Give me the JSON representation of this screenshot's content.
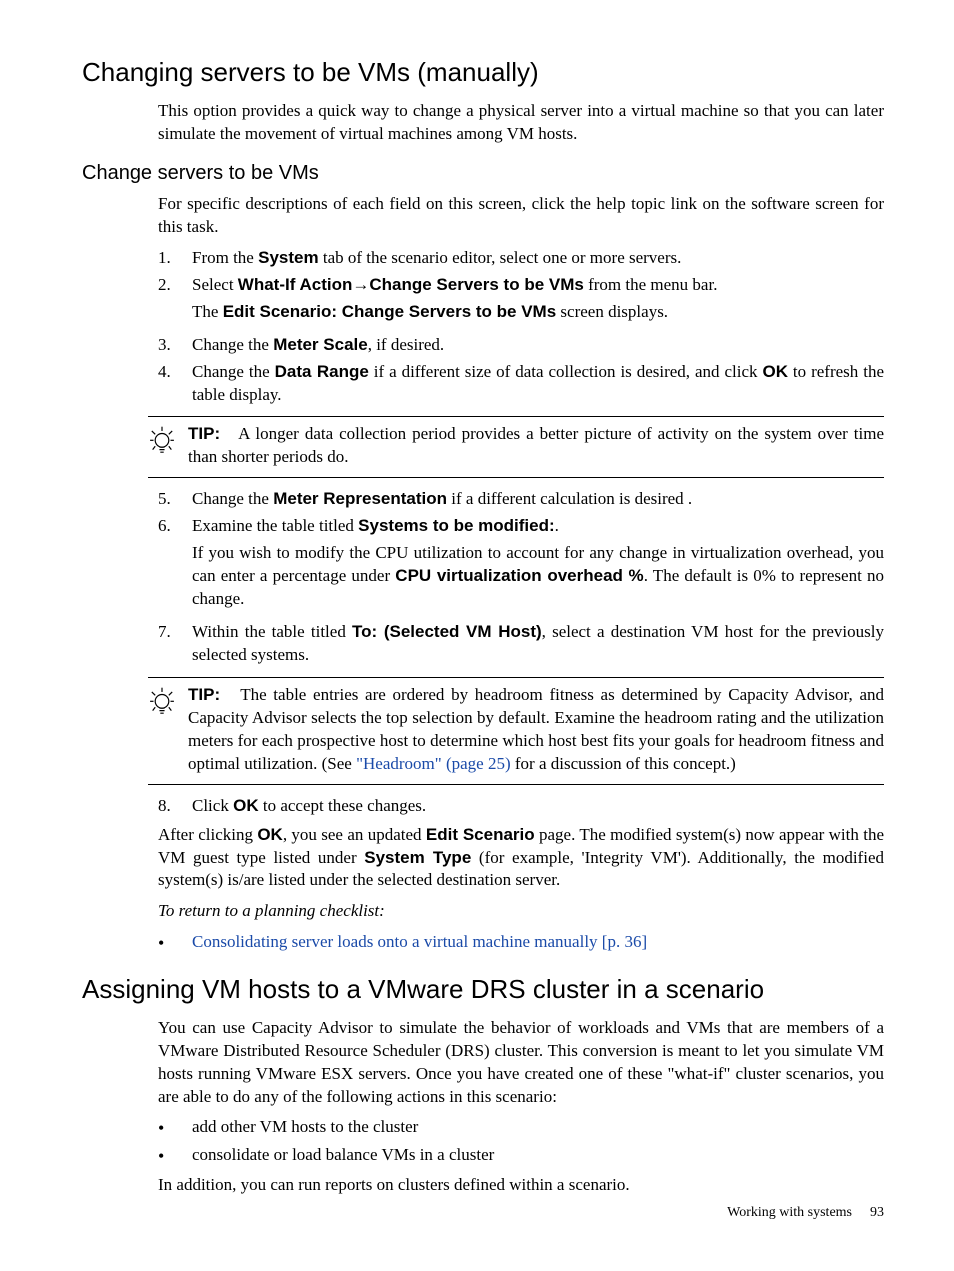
{
  "section1": {
    "title": "Changing servers to be VMs (manually)",
    "intro": "This option provides a quick way to change a physical server into a virtual machine so that you can later simulate the movement of virtual machines among VM hosts.",
    "subheading": "Change servers to be VMs",
    "sub_intro": "For specific descriptions of each field on this screen, click the help topic link on the software screen for this task.",
    "steps_a": {
      "s1_pre": "From the ",
      "s1_system": "System",
      "s1_post": " tab of the scenario editor, select one or more servers.",
      "s2_pre": "Select ",
      "s2_whatif": "What-If Action",
      "s2_arrow": "→",
      "s2_change": "Change Servers to be VMs",
      "s2_post": " from the menu bar.",
      "s2_line2_pre": "The ",
      "s2_line2_bold": "Edit Scenario: Change Servers to be VMs",
      "s2_line2_post": " screen displays.",
      "s3_pre": "Change the ",
      "s3_bold": "Meter Scale",
      "s3_post": ", if desired.",
      "s4_pre": "Change the ",
      "s4_bold": "Data Range",
      "s4_mid": " if a different size of data collection is desired, and click ",
      "s4_ok": "OK",
      "s4_post": " to refresh the table display."
    },
    "tip1_label": "TIP:",
    "tip1_text": "A longer data collection period provides a better picture of activity on the system over time than shorter periods do.",
    "steps_b": {
      "s5_pre": "Change the ",
      "s5_bold": "Meter Representation",
      "s5_post": " if a different calculation is desired .",
      "s6_pre": "Examine the table titled ",
      "s6_bold": "Systems to be modified:",
      "s6_post": ".",
      "s6_p_pre": "If you wish to modify the CPU utilization to account for any change in virtualization overhead, you can enter a percentage under ",
      "s6_p_bold": "CPU virtualization overhead %",
      "s6_p_post": ". The default is 0% to represent no change.",
      "s7_pre": "Within the table titled ",
      "s7_bold": "To: (Selected VM Host)",
      "s7_post": ", select a destination VM host for the previously selected systems."
    },
    "tip2_label": "TIP:",
    "tip2_pre": "The table entries are ordered by headroom fitness as determined by Capacity Advisor, and Capacity Advisor selects the top selection by default. Examine the headroom rating and the utilization meters for each prospective host to determine which host best fits your goals for headroom fitness and optimal utilization. (See ",
    "tip2_link": "\"Headroom\" (page 25)",
    "tip2_post": " for a discussion of this concept.)",
    "steps_c": {
      "s8_pre": "Click ",
      "s8_ok": "OK",
      "s8_post": " to accept these changes."
    },
    "after_pre": "After clicking ",
    "after_ok": "OK",
    "after_mid1": ", you see an updated ",
    "after_edit": "Edit Scenario",
    "after_mid2": " page. The modified system(s) now appear with the VM guest type listed under ",
    "after_systype": "System Type",
    "after_post": " (for example, 'Integrity VM'). Additionally, the modified system(s) is/are listed under the selected destination server.",
    "return_text": "To return to a planning checklist:",
    "return_link": "Consolidating server loads onto a virtual machine manually [p. 36]"
  },
  "section2": {
    "title": "Assigning VM hosts to a VMware DRS cluster in a scenario",
    "intro": "You can use Capacity Advisor to simulate the behavior of workloads and VMs that are members of a VMware Distributed Resource Scheduler (DRS) cluster. This conversion is meant to let you simulate VM hosts running VMware ESX servers. Once you have created one of these \"what-if\" cluster scenarios, you are able to do any of the following actions in this scenario:",
    "b1": "add other VM hosts to the cluster",
    "b2": "consolidate or load balance VMs in a cluster",
    "outro": "In addition, you can run reports on clusters defined within a scenario."
  },
  "footer": {
    "text": "Working with systems",
    "page": "93"
  },
  "nums": {
    "n1": "1.",
    "n2": "2.",
    "n3": "3.",
    "n4": "4.",
    "n5": "5.",
    "n6": "6.",
    "n7": "7.",
    "n8": "8."
  }
}
